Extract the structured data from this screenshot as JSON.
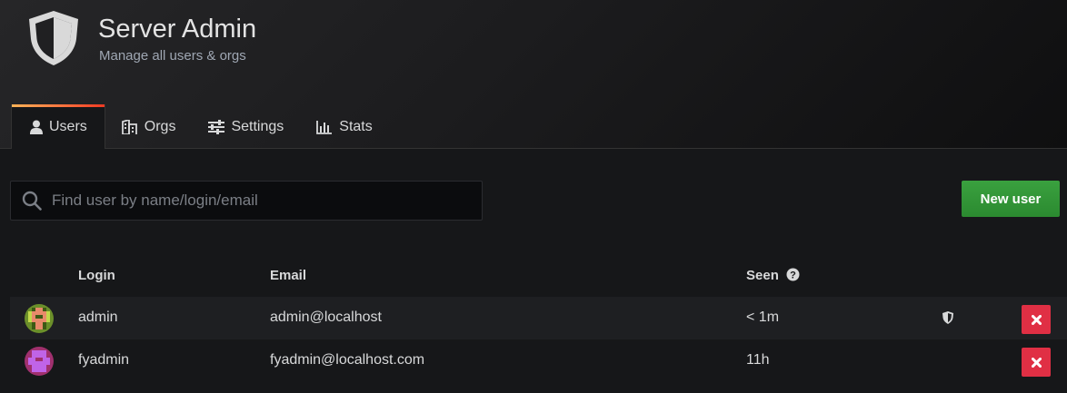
{
  "header": {
    "title": "Server Admin",
    "subtitle": "Manage all users & orgs"
  },
  "tabs": [
    {
      "label": "Users",
      "icon": "user-icon",
      "active": true
    },
    {
      "label": "Orgs",
      "icon": "building-icon",
      "active": false
    },
    {
      "label": "Settings",
      "icon": "sliders-icon",
      "active": false
    },
    {
      "label": "Stats",
      "icon": "bar-chart-icon",
      "active": false
    }
  ],
  "search": {
    "placeholder": "Find user by name/login/email",
    "value": ""
  },
  "new_user_button": "New user",
  "table": {
    "columns": {
      "login": "Login",
      "email": "Email",
      "seen": "Seen"
    },
    "rows": [
      {
        "login": "admin",
        "email": "admin@localhost",
        "seen": "< 1m",
        "is_admin": true
      },
      {
        "login": "fyadmin",
        "email": "fyadmin@localhost.com",
        "seen": "11h",
        "is_admin": false
      }
    ]
  },
  "colors": {
    "accent_gradient": [
      "#ffb357",
      "#ff7941",
      "#ee3a23"
    ],
    "primary_button": "#2b8a30",
    "danger_button": "#e02f44",
    "background": "#161719"
  }
}
